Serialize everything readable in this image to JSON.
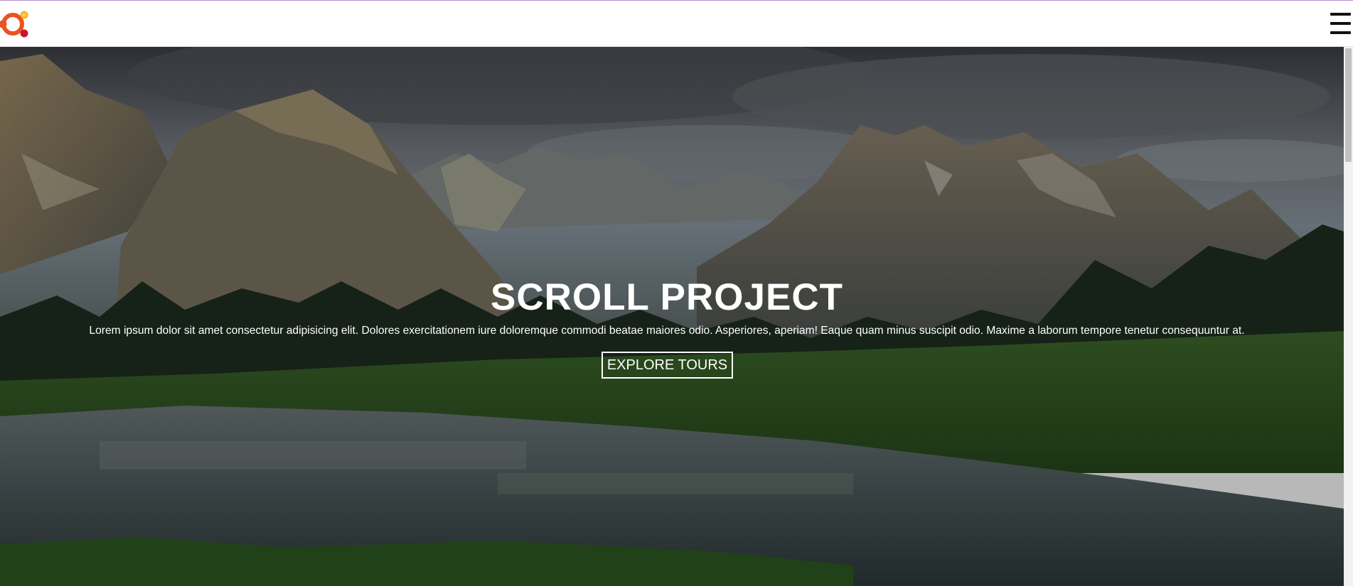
{
  "navbar": {
    "logo_icon": "ubuntu-circle-logo-icon",
    "menu_icon": "hamburger-menu-icon"
  },
  "hero": {
    "title": "SCROLL PROJECT",
    "text": "Lorem ipsum dolor sit amet consectetur adipisicing elit. Dolores exercitationem iure doloremque commodi beatae maiores odio. Asperiores, aperiam! Eaque quam minus suscipit odio. Maxime a laborum tempore tenetur consequuntur at.",
    "button_label": "EXPLORE TOURS",
    "background_image": "mountain-lake-landscape"
  },
  "colors": {
    "accent_line": "#b48ac9",
    "logo_orange": "#e95420",
    "logo_red": "#c7162b",
    "logo_yellow": "#f7b21d",
    "text": "#ffffff"
  }
}
